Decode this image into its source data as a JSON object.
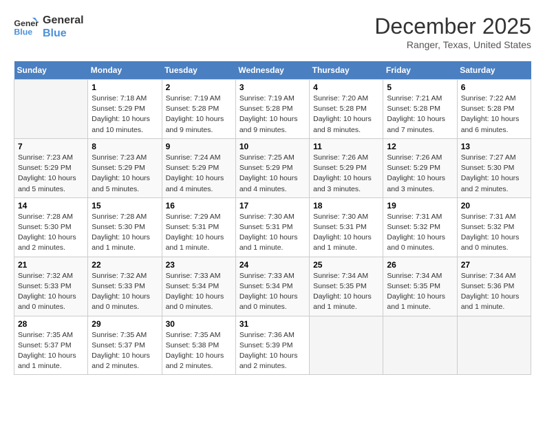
{
  "logo": {
    "line1": "General",
    "line2": "Blue"
  },
  "title": "December 2025",
  "subtitle": "Ranger, Texas, United States",
  "days_header": [
    "Sunday",
    "Monday",
    "Tuesday",
    "Wednesday",
    "Thursday",
    "Friday",
    "Saturday"
  ],
  "weeks": [
    [
      {
        "day": "",
        "info": ""
      },
      {
        "day": "1",
        "info": "Sunrise: 7:18 AM\nSunset: 5:29 PM\nDaylight: 10 hours\nand 10 minutes."
      },
      {
        "day": "2",
        "info": "Sunrise: 7:19 AM\nSunset: 5:28 PM\nDaylight: 10 hours\nand 9 minutes."
      },
      {
        "day": "3",
        "info": "Sunrise: 7:19 AM\nSunset: 5:28 PM\nDaylight: 10 hours\nand 9 minutes."
      },
      {
        "day": "4",
        "info": "Sunrise: 7:20 AM\nSunset: 5:28 PM\nDaylight: 10 hours\nand 8 minutes."
      },
      {
        "day": "5",
        "info": "Sunrise: 7:21 AM\nSunset: 5:28 PM\nDaylight: 10 hours\nand 7 minutes."
      },
      {
        "day": "6",
        "info": "Sunrise: 7:22 AM\nSunset: 5:28 PM\nDaylight: 10 hours\nand 6 minutes."
      }
    ],
    [
      {
        "day": "7",
        "info": "Sunrise: 7:23 AM\nSunset: 5:29 PM\nDaylight: 10 hours\nand 5 minutes."
      },
      {
        "day": "8",
        "info": "Sunrise: 7:23 AM\nSunset: 5:29 PM\nDaylight: 10 hours\nand 5 minutes."
      },
      {
        "day": "9",
        "info": "Sunrise: 7:24 AM\nSunset: 5:29 PM\nDaylight: 10 hours\nand 4 minutes."
      },
      {
        "day": "10",
        "info": "Sunrise: 7:25 AM\nSunset: 5:29 PM\nDaylight: 10 hours\nand 4 minutes."
      },
      {
        "day": "11",
        "info": "Sunrise: 7:26 AM\nSunset: 5:29 PM\nDaylight: 10 hours\nand 3 minutes."
      },
      {
        "day": "12",
        "info": "Sunrise: 7:26 AM\nSunset: 5:29 PM\nDaylight: 10 hours\nand 3 minutes."
      },
      {
        "day": "13",
        "info": "Sunrise: 7:27 AM\nSunset: 5:30 PM\nDaylight: 10 hours\nand 2 minutes."
      }
    ],
    [
      {
        "day": "14",
        "info": "Sunrise: 7:28 AM\nSunset: 5:30 PM\nDaylight: 10 hours\nand 2 minutes."
      },
      {
        "day": "15",
        "info": "Sunrise: 7:28 AM\nSunset: 5:30 PM\nDaylight: 10 hours\nand 1 minute."
      },
      {
        "day": "16",
        "info": "Sunrise: 7:29 AM\nSunset: 5:31 PM\nDaylight: 10 hours\nand 1 minute."
      },
      {
        "day": "17",
        "info": "Sunrise: 7:30 AM\nSunset: 5:31 PM\nDaylight: 10 hours\nand 1 minute."
      },
      {
        "day": "18",
        "info": "Sunrise: 7:30 AM\nSunset: 5:31 PM\nDaylight: 10 hours\nand 1 minute."
      },
      {
        "day": "19",
        "info": "Sunrise: 7:31 AM\nSunset: 5:32 PM\nDaylight: 10 hours\nand 0 minutes."
      },
      {
        "day": "20",
        "info": "Sunrise: 7:31 AM\nSunset: 5:32 PM\nDaylight: 10 hours\nand 0 minutes."
      }
    ],
    [
      {
        "day": "21",
        "info": "Sunrise: 7:32 AM\nSunset: 5:33 PM\nDaylight: 10 hours\nand 0 minutes."
      },
      {
        "day": "22",
        "info": "Sunrise: 7:32 AM\nSunset: 5:33 PM\nDaylight: 10 hours\nand 0 minutes."
      },
      {
        "day": "23",
        "info": "Sunrise: 7:33 AM\nSunset: 5:34 PM\nDaylight: 10 hours\nand 0 minutes."
      },
      {
        "day": "24",
        "info": "Sunrise: 7:33 AM\nSunset: 5:34 PM\nDaylight: 10 hours\nand 0 minutes."
      },
      {
        "day": "25",
        "info": "Sunrise: 7:34 AM\nSunset: 5:35 PM\nDaylight: 10 hours\nand 1 minute."
      },
      {
        "day": "26",
        "info": "Sunrise: 7:34 AM\nSunset: 5:35 PM\nDaylight: 10 hours\nand 1 minute."
      },
      {
        "day": "27",
        "info": "Sunrise: 7:34 AM\nSunset: 5:36 PM\nDaylight: 10 hours\nand 1 minute."
      }
    ],
    [
      {
        "day": "28",
        "info": "Sunrise: 7:35 AM\nSunset: 5:37 PM\nDaylight: 10 hours\nand 1 minute."
      },
      {
        "day": "29",
        "info": "Sunrise: 7:35 AM\nSunset: 5:37 PM\nDaylight: 10 hours\nand 2 minutes."
      },
      {
        "day": "30",
        "info": "Sunrise: 7:35 AM\nSunset: 5:38 PM\nDaylight: 10 hours\nand 2 minutes."
      },
      {
        "day": "31",
        "info": "Sunrise: 7:36 AM\nSunset: 5:39 PM\nDaylight: 10 hours\nand 2 minutes."
      },
      {
        "day": "",
        "info": ""
      },
      {
        "day": "",
        "info": ""
      },
      {
        "day": "",
        "info": ""
      }
    ]
  ]
}
